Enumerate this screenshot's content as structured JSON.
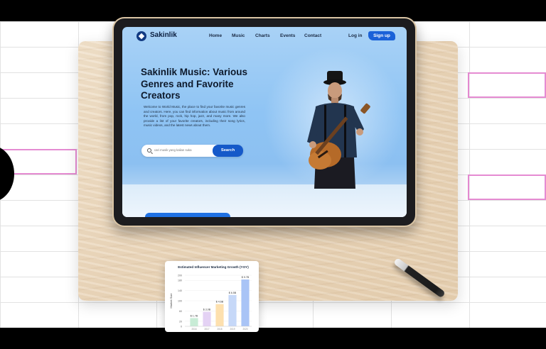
{
  "site": {
    "brand": "Sakinlik",
    "nav": [
      "Home",
      "Music",
      "Charts",
      "Events",
      "Contact"
    ],
    "login": "Log in",
    "signup": "Sign up"
  },
  "hero": {
    "title": "Sakinlik Music: Various Genres and Favorite Creators",
    "description": "Welcome to World Music, the place to find your favorite music genres and creators. Here, you can find information about music from around the world, from pop, rock, hip hop, jazz, and many more. We also provide a list of your favorite creators, including their song lyrics, music videos, and the latest news about them.",
    "search_placeholder": "cari musik yang kalian suka",
    "search_button": "Search"
  },
  "colors": {
    "accent": "#1a61d8",
    "brand_dark": "#123a82",
    "screen_sky": "#8fc4f4",
    "highlight_border": "#e58bd2"
  },
  "icons": [
    "logo-icon",
    "search-icon"
  ],
  "chart_data": {
    "type": "bar",
    "title": "Estimated Influencer Marketing Growth (YOY)",
    "ylabel": "Market Size",
    "ylim": [
      0,
      200
    ],
    "yticks": [
      0,
      20,
      60,
      100,
      140,
      180,
      200
    ],
    "categories": [
      "2016",
      "2017",
      "2018",
      "2019",
      "2020"
    ],
    "values": [
      1.7,
      3.0,
      4.6,
      6.5,
      9.7
    ],
    "value_labels": [
      "$ 1.7B",
      "$ 3.0B",
      "$ 4.6B",
      "$ 6.5B",
      "$ 9.7B"
    ],
    "colors": [
      "#c8ecd6",
      "#e4d2f4",
      "#fde0ae",
      "#c6d8f8",
      "#a9c4f6"
    ]
  }
}
